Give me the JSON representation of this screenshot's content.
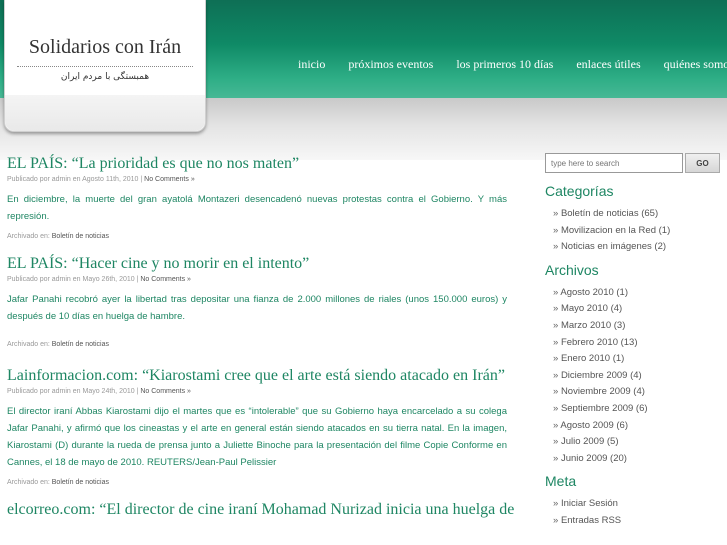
{
  "site": {
    "title": "Solidarios con Irán",
    "tagline": "همبستگی با مردم ایران"
  },
  "nav": [
    "inicio",
    "próximos eventos",
    "los primeros 10 días",
    "enlaces útiles",
    "quiénes somos"
  ],
  "posts": [
    {
      "title": "EL PAÍS: “La prioridad es que no nos maten”",
      "meta": "Publicado por admin en Agosto 11th, 2010 |",
      "comments": "No Comments »",
      "body": "En diciembre, la muerte del gran ayatolá Montazeri desencadenó nuevas protestas contra el Gobierno. Y más represión.",
      "filed_label": "Archivado en:",
      "category": "Boletín de noticias"
    },
    {
      "title": "EL PAÍS: “Hacer cine y no morir en el intento”",
      "meta": "Publicado por admin en Mayo 26th, 2010 |",
      "comments": "No Comments »",
      "body": "Jafar Panahi recobró ayer la libertad tras depositar una fianza de 2.000 millones de riales (unos 150.000 euros) y después de 10 días en huelga de hambre.",
      "filed_label": "Archivado en:",
      "category": "Boletín de noticias"
    },
    {
      "title": "Lainformacion.com: “Kiarostami cree que el arte está siendo atacado en Irán”",
      "meta": "Publicado por admin en Mayo 24th, 2010 |",
      "comments": "No Comments »",
      "body": "El director iraní Abbas Kiarostami dijo el martes que es “intolerable” que su Gobierno haya encarcelado a su colega Jafar Panahi, y afirmó que los cineastas y el arte en general están siendo atacados en su tierra natal. En la imagen, Kiarostami (D) durante la rueda de prensa junto a Juliette Binoche para la presentación del filme Copie Conforme en Cannes, el 18 de mayo de 2010. REUTERS/Jean-Paul Pelissier",
      "filed_label": "Archivado en:",
      "category": "Boletín de noticias"
    },
    {
      "title": "elcorreo.com: “El director de cine iraní Mohamad Nurizad inicia una huelga de"
    }
  ],
  "search": {
    "placeholder": "type here to search",
    "button": "GO"
  },
  "sidebar": {
    "categories_heading": "Categorías",
    "categories": [
      "Boletín de noticias (65)",
      "Movilizacion en la Red (1)",
      "Noticias en imágenes (2)"
    ],
    "archives_heading": "Archivos",
    "archives": [
      "Agosto 2010 (1)",
      "Mayo 2010 (4)",
      "Marzo 2010 (3)",
      "Febrero 2010 (13)",
      "Enero 2010 (1)",
      "Diciembre 2009 (4)",
      "Noviembre 2009 (4)",
      "Septiembre 2009 (6)",
      "Agosto 2009 (6)",
      "Julio 2009 (5)",
      "Junio 2009 (20)"
    ],
    "meta_heading": "Meta",
    "meta": [
      "Iniciar Sesión",
      "Entradas RSS"
    ]
  },
  "colors": {
    "brand_green": "#0f8a66",
    "link_green": "#1e8663"
  }
}
